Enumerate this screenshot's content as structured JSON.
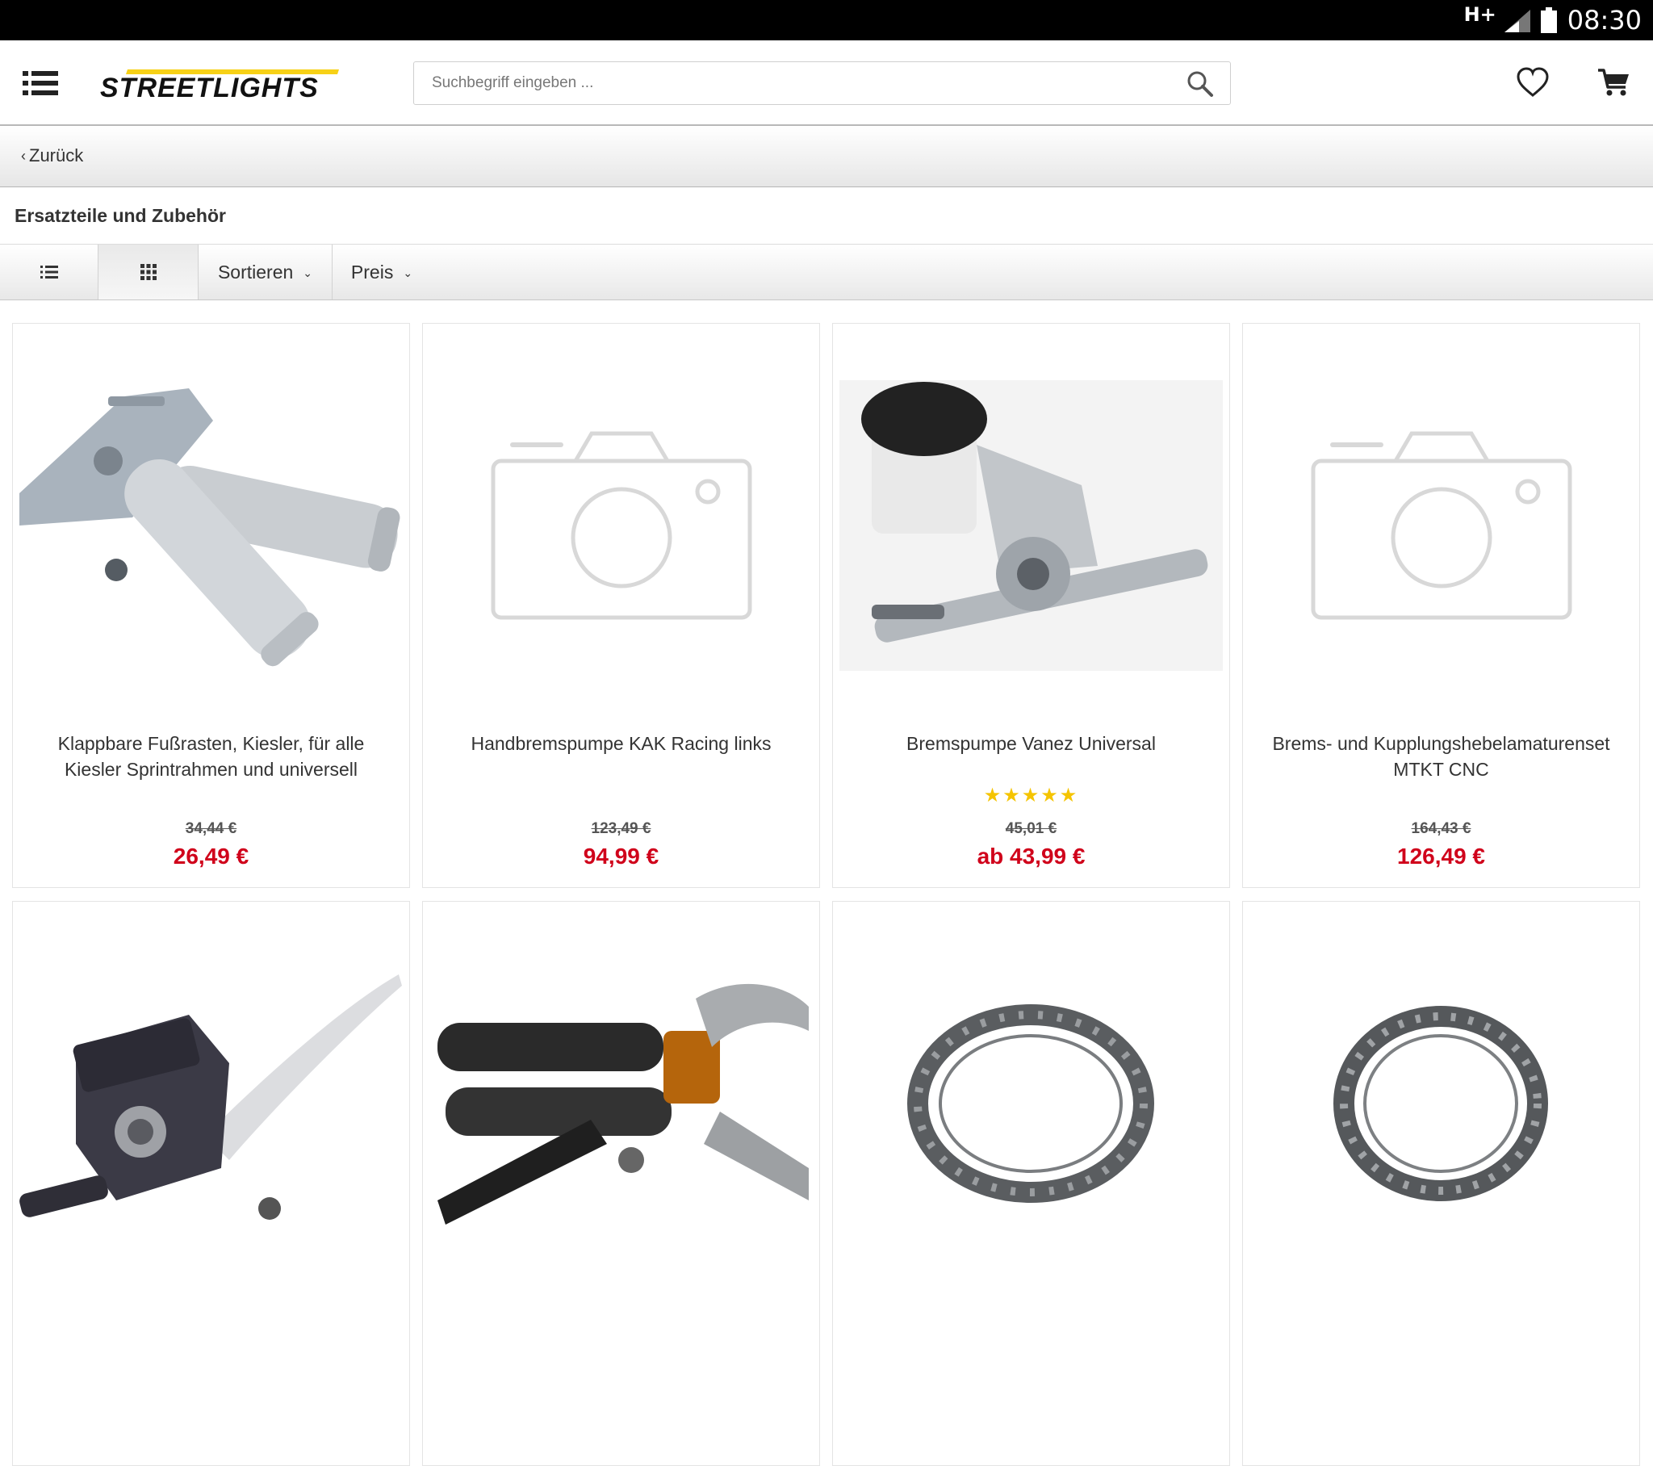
{
  "status_bar": {
    "network": "H+",
    "time": "08:30"
  },
  "header": {
    "logo_text": "STREETLIGHTS",
    "search_placeholder": "Suchbegriff eingeben ..."
  },
  "nav": {
    "back_label": "Zurück"
  },
  "category": {
    "title": "Ersatzteile und Zubehör"
  },
  "toolbar": {
    "sort_label": "Sortieren",
    "price_label": "Preis"
  },
  "colors": {
    "price_red": "#d0021b",
    "star_yellow": "#f5c400",
    "logo_yellow": "#f7d117"
  },
  "products": [
    {
      "name": "Klappbare Fußrasten, Kiesler, für alle Kiesler Sprintrahmen und universell",
      "old_price": "34,44 €",
      "price": "26,49 €",
      "image": "footpeg-photo"
    },
    {
      "name": "Handbremspumpe KAK Racing links",
      "old_price": "123,49 €",
      "price": "94,99 €",
      "image": "placeholder-camera"
    },
    {
      "name": "Bremspumpe Vanez Universal",
      "rating": 5,
      "stars": "★★★★★",
      "old_price": "45,01 €",
      "price": "ab 43,99 €",
      "image": "brake-pump-photo"
    },
    {
      "name": "Brems- und Kupplungshebelamaturenset MTKT CNC",
      "old_price": "164,43 €",
      "price": "126,49 €",
      "image": "placeholder-camera"
    },
    {
      "name": "",
      "image": "black-master-cylinder-photo"
    },
    {
      "name": "",
      "image": "grips-levers-photo"
    },
    {
      "name": "",
      "image": "bearing-ring-photo"
    },
    {
      "name": "",
      "image": "bearing-ring-photo"
    }
  ]
}
